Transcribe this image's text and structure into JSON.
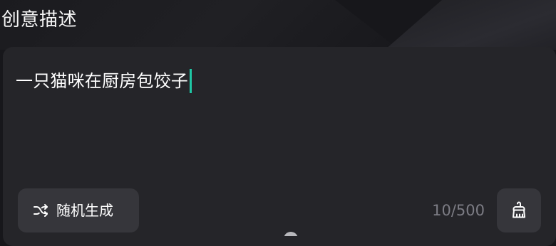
{
  "section_title": "创意描述",
  "prompt": {
    "text": "一只猫咪在厨房包饺子",
    "caret_color": "#1fc7a5"
  },
  "random_button": {
    "label": "随机生成",
    "icon": "shuffle-icon"
  },
  "counter": {
    "text": "10/500"
  },
  "clear_button": {
    "icon": "brush-clear-icon"
  },
  "bottom_notice": {
    "icon": "info-circle-icon"
  }
}
